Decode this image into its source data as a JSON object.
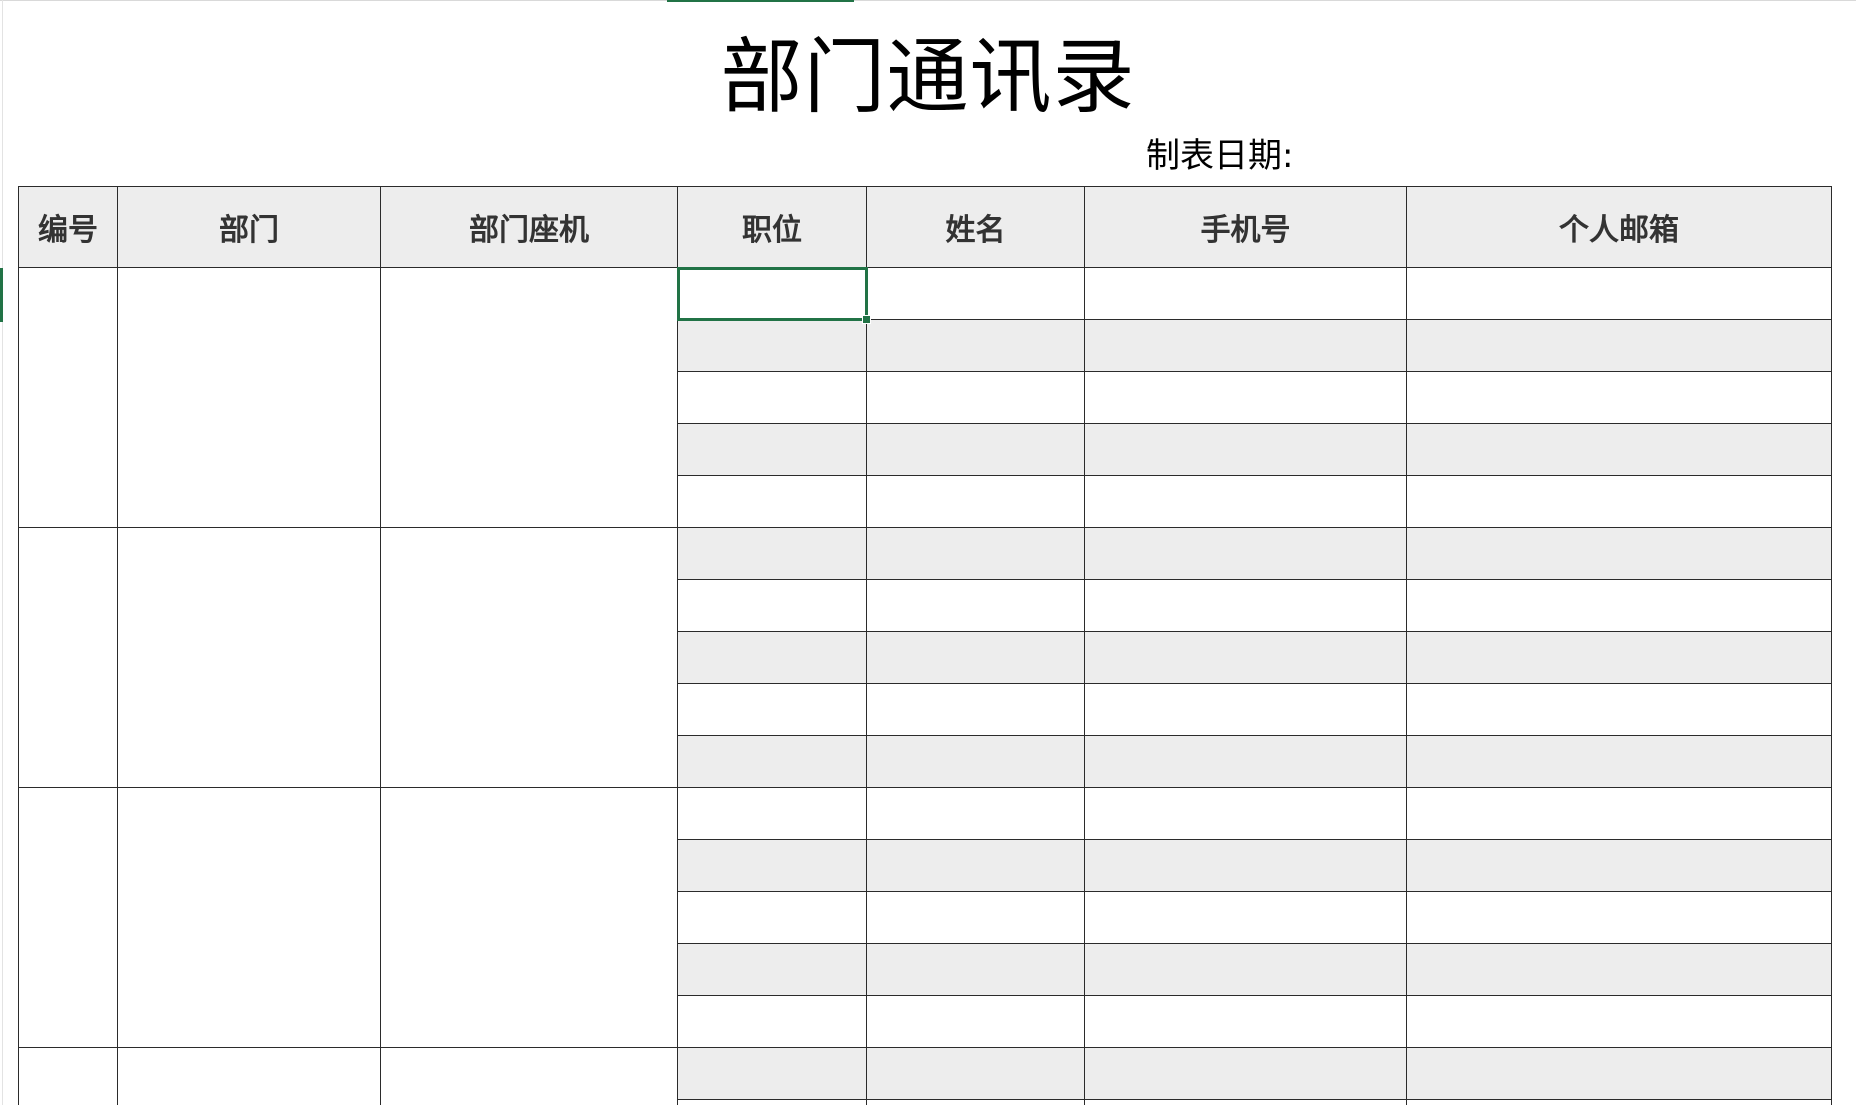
{
  "sheet": {
    "title": "部门通讯录",
    "date_label": "制表日期:",
    "accent_color": "#217346",
    "header_fill": "#ededed"
  },
  "table": {
    "columns": [
      "编号",
      "部门",
      "部门座机",
      "职位",
      "姓名",
      "手机号",
      "个人邮箱"
    ]
  }
}
